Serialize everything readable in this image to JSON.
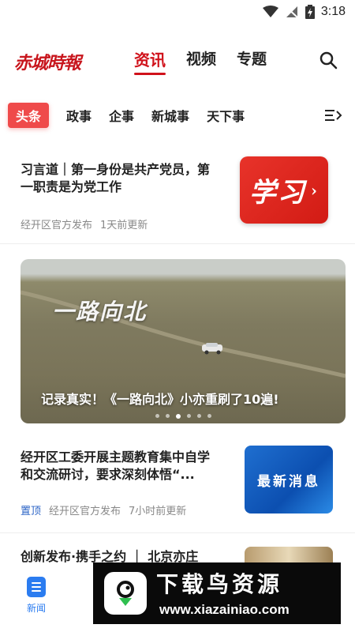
{
  "status_bar": {
    "time": "3:18"
  },
  "header": {
    "logo": "赤城時報",
    "tabs": [
      {
        "label": "资讯",
        "active": true
      },
      {
        "label": "视频",
        "active": false
      },
      {
        "label": "专题",
        "active": false
      }
    ]
  },
  "channels": [
    "头条",
    "政事",
    "企事",
    "新城事",
    "天下事"
  ],
  "feed": {
    "article1": {
      "title": "习言道｜第一身份是共产党员，第一职责是为党工作",
      "source": "经开区官方发布",
      "time": "1天前更新",
      "thumb_text": "学习"
    },
    "banner": {
      "overlay_text": "一路向北",
      "caption": "记录真实！《一路向北》小亦重刷了10遍!",
      "dots_count": 6,
      "active_dot": 2
    },
    "article2": {
      "title": "经开区工委开展主题教育集中自学和交流研讨，要求深刻体悟“...",
      "pin_label": "置顶",
      "source": "经开区官方发布",
      "time": "7小时前更新",
      "thumb_text": "最新消息"
    },
    "article3": {
      "title": "创新发布·携手之约 ｜ 北京亦庄"
    }
  },
  "bottom_nav": {
    "items": [
      {
        "label": "新闻",
        "icon": "news-icon",
        "active": true
      }
    ]
  },
  "watermark": {
    "title": "下载鸟资源",
    "url": "www.xiazainiao.com"
  },
  "colors": {
    "brand_red": "#d0121b",
    "channel_active_bg": "#ef4a4a",
    "pin_blue": "#2b64c6",
    "nav_blue": "#2b7cf0"
  }
}
